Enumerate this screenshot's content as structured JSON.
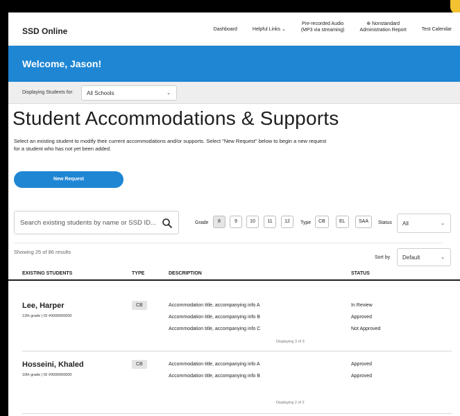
{
  "header": {
    "logo": "SSD Online",
    "nav": {
      "dashboard": "Dashboard",
      "helpful_links": "Helpful Links",
      "audio_line1": "Pre-recorded Audio",
      "audio_line2": "(MP3 via streaming)",
      "nonstandard_line1": "⊕ Nonstandard",
      "nonstandard_line2": "Administration Report",
      "test_calendar": "Test Calendar"
    }
  },
  "banner": {
    "welcome": "Welcome, Jason!"
  },
  "school_filter": {
    "label": "Displaying Students for:",
    "value": "All Schools"
  },
  "page": {
    "title": "Student Accommodations & Supports",
    "intro": "Select an existing student to modify their current accommodations and/or supports. Select \"New Request\" below to begin a new request for a student who has not yet been added.",
    "new_request": "New Request"
  },
  "search": {
    "placeholder": "Search existing students by name or SSD ID..."
  },
  "filters": {
    "grade_label": "Grade",
    "grades": [
      "8",
      "9",
      "10",
      "11",
      "12"
    ],
    "type_label": "Type",
    "types": [
      "CB",
      "EL",
      "SAA"
    ],
    "status_label": "Status",
    "status_value": "All"
  },
  "results": {
    "showing": "Showing 25 of 86 results",
    "sort_label": "Sort by",
    "sort_value": "Default"
  },
  "table": {
    "headers": {
      "students": "EXISTING STUDENTS",
      "type": "TYPE",
      "description": "DESCRIPTION",
      "status": "STATUS"
    },
    "rows": [
      {
        "name": "Lee, Harper",
        "meta": "12th grade  |  ID #0000000000",
        "type": "CB",
        "items": [
          {
            "desc": "Accommodation title, accompanying info A",
            "status": "In Review"
          },
          {
            "desc": "Accommodation title, accompanying info B",
            "status": "Approved"
          },
          {
            "desc": "Accommodation title, accompanying info C",
            "status": "Not Approved"
          }
        ],
        "displaying": "Displaying 3 of 3"
      },
      {
        "name": "Hosseini, Khaled",
        "meta": "10th grade  |  ID #0000000000",
        "type": "CB",
        "items": [
          {
            "desc": "Accommodation title, accompanying info A",
            "status": "Approved"
          },
          {
            "desc": "Accommodation title, accompanying info B",
            "status": "Approved"
          }
        ],
        "displaying": "Displaying 2 of 2"
      }
    ]
  }
}
